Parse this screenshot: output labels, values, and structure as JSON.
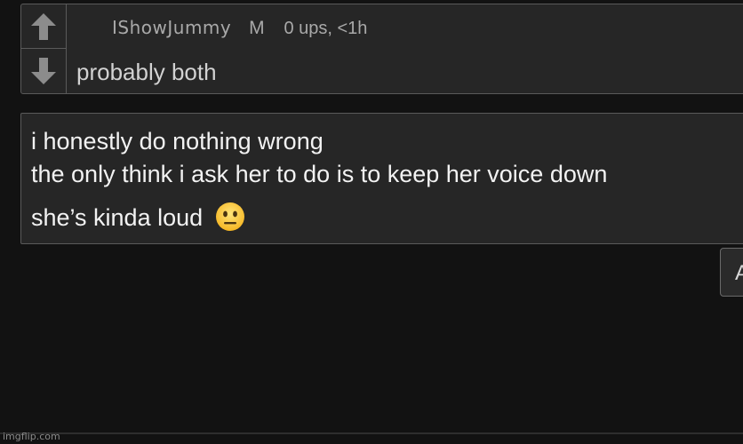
{
  "comment": {
    "username": "IShowJummy",
    "badge": "M",
    "stats": "0 ups, <1h",
    "text": "probably both",
    "upvote_icon": "arrow-up-icon",
    "downvote_icon": "arrow-down-icon"
  },
  "reply": {
    "lines": [
      "i honestly do nothing wrong",
      "the only think i ask her to do is to keep her voice down",
      "she’s kinda loud"
    ],
    "emoji": "neutral-face-emoji"
  },
  "side_button": {
    "label": "A"
  },
  "watermark": "imgflip.com",
  "colors": {
    "background": "#121212",
    "card": "#262626",
    "border": "#5a5a5a",
    "text": "#f2f2f2",
    "meta": "#a9a9a9"
  }
}
